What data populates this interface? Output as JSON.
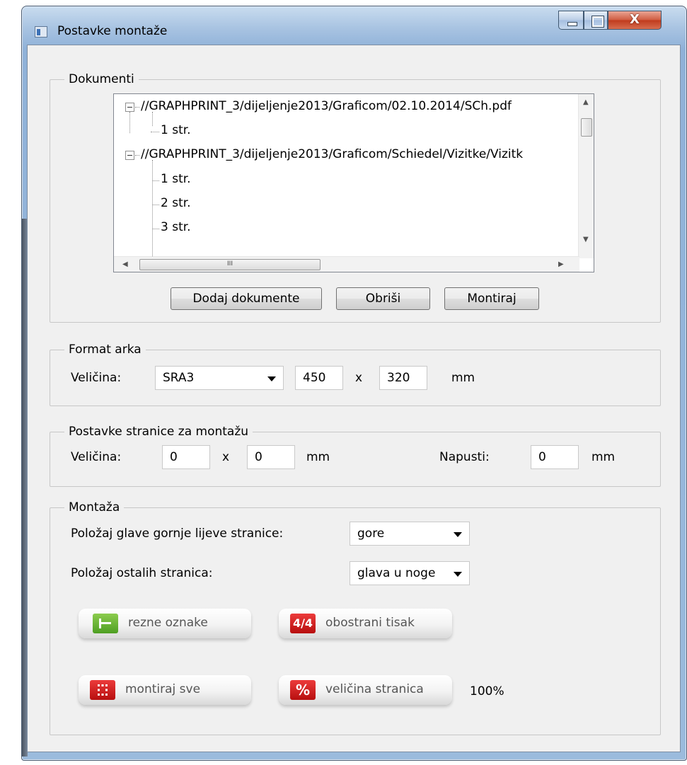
{
  "window": {
    "title": "Postavke montaže",
    "close_glyph": "X"
  },
  "documents": {
    "legend": "Dokumenti",
    "tree": [
      {
        "level": 0,
        "text": "//GRAPHPRINT_3/dijeljenje2013/Graficom/02.10.2014/SCh.pdf"
      },
      {
        "level": 1,
        "text": "1 str."
      },
      {
        "level": 0,
        "text": "//GRAPHPRINT_3/dijeljenje2013/Graficom/Schiedel/Vizitke/Vizitk"
      },
      {
        "level": 1,
        "text": "1 str."
      },
      {
        "level": 1,
        "text": "2 str."
      },
      {
        "level": 1,
        "text": "3 str."
      }
    ],
    "hscroll_glyph": "III",
    "buttons": {
      "add": "Dodaj dokumente",
      "delete": "Obriši",
      "mount": "Montiraj"
    }
  },
  "sheet_format": {
    "legend": "Format arka",
    "size_label": "Veličina:",
    "preset": "SRA3",
    "width": "450",
    "times": "x",
    "height": "320",
    "unit": "mm"
  },
  "page_settings": {
    "legend": "Postavke stranice za montažu",
    "size_label": "Veličina:",
    "width": "0",
    "times": "x",
    "height": "0",
    "unit": "mm",
    "bleed_label": "Napusti:",
    "bleed": "0",
    "bleed_unit": "mm"
  },
  "mounting": {
    "legend": "Montaža",
    "head_position_label": "Položaj glave gornje lijeve stranice:",
    "head_position_value": "gore",
    "other_pages_label": "Položaj ostalih stranica:",
    "other_pages_value": "glava u noge",
    "tools": {
      "crop_marks": {
        "icon_text": "",
        "label": "rezne oznake",
        "color": "#5aae2b"
      },
      "duplex": {
        "icon_text": "4/4",
        "label": "obostrani tisak",
        "color": "#cc1c1c"
      },
      "mount_all": {
        "icon_text": "",
        "label": "montiraj sve",
        "color": "#cc1c1c"
      },
      "page_size": {
        "icon_text": "%",
        "label": "veličina stranica",
        "color": "#cc1c1c"
      }
    },
    "scale": "100%"
  }
}
